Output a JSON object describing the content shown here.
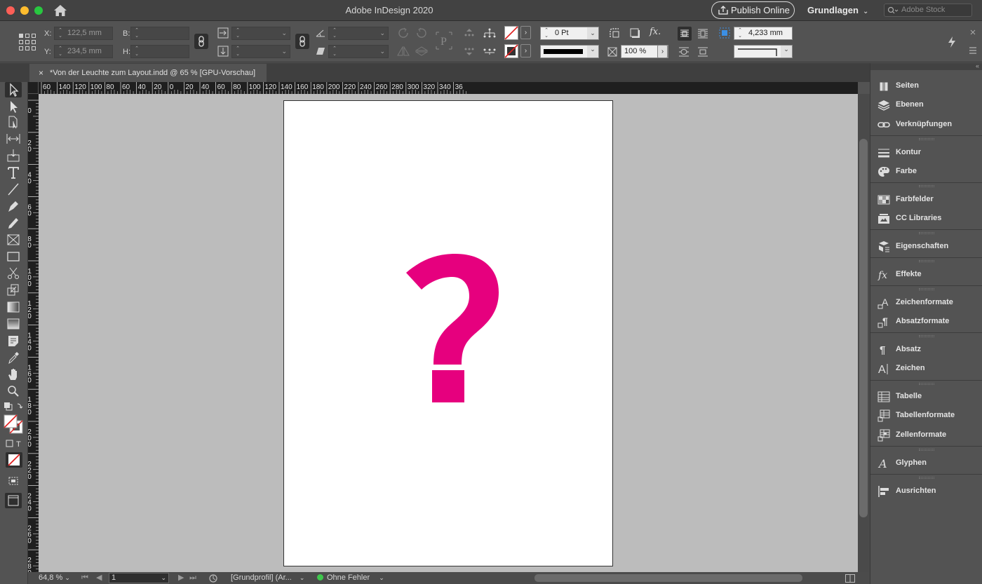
{
  "app": {
    "title": "Adobe InDesign 2020",
    "publish_label": "Publish Online",
    "workspace_label": "Grundlagen",
    "stock_search_placeholder": "Adobe Stock"
  },
  "control_panel": {
    "x_label": "X:",
    "x_value": "122,5 mm",
    "y_label": "Y:",
    "y_value": "234,5 mm",
    "w_label": "B:",
    "h_label": "H:",
    "stroke_weight": "0 Pt",
    "opacity": "100 %",
    "gap_value": "4,233 mm"
  },
  "document_tab": {
    "title": "*Von der Leuchte zum Layout.indd @ 65 % [GPU-Vorschau]"
  },
  "ruler_h_labels": [
    "60",
    "140",
    "120",
    "100",
    "80",
    "60",
    "40",
    "20",
    "0",
    "20",
    "40",
    "60",
    "80",
    "100",
    "120",
    "140",
    "160",
    "180",
    "200",
    "220",
    "240",
    "260",
    "280",
    "300",
    "320",
    "340",
    "36"
  ],
  "ruler_v_labels": [
    "0",
    "20",
    "40",
    "60",
    "80",
    "100",
    "120",
    "140",
    "160",
    "180",
    "200",
    "220",
    "240",
    "260",
    "280"
  ],
  "canvas": {
    "glyph": "?",
    "glyph_color": "#e6007e"
  },
  "status_bar": {
    "zoom": "64,8 %",
    "page": "1",
    "profile": "[Grundprofil] (Ar...",
    "preflight": "Ohne Fehler"
  },
  "panels": [
    {
      "label": "Seiten",
      "icon": "pages-icon"
    },
    {
      "label": "Ebenen",
      "icon": "layers-icon"
    },
    {
      "label": "Verknüpfungen",
      "icon": "links-icon"
    },
    {
      "label": "Kontur",
      "icon": "stroke-icon"
    },
    {
      "label": "Farbe",
      "icon": "color-icon"
    },
    {
      "label": "Farbfelder",
      "icon": "swatches-icon"
    },
    {
      "label": "CC Libraries",
      "icon": "cc-libraries-icon"
    },
    {
      "label": "Eigenschaften",
      "icon": "properties-icon"
    },
    {
      "label": "Effekte",
      "icon": "effects-icon"
    },
    {
      "label": "Zeichenformate",
      "icon": "character-styles-icon"
    },
    {
      "label": "Absatzformate",
      "icon": "paragraph-styles-icon"
    },
    {
      "label": "Absatz",
      "icon": "paragraph-icon"
    },
    {
      "label": "Zeichen",
      "icon": "character-icon"
    },
    {
      "label": "Tabelle",
      "icon": "table-icon"
    },
    {
      "label": "Tabellenformate",
      "icon": "table-styles-icon"
    },
    {
      "label": "Zellenformate",
      "icon": "cell-styles-icon"
    },
    {
      "label": "Glyphen",
      "icon": "glyphs-icon"
    },
    {
      "label": "Ausrichten",
      "icon": "align-icon"
    }
  ]
}
